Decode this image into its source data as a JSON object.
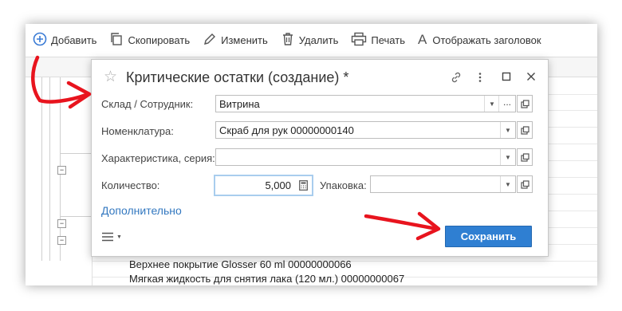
{
  "toolbar": {
    "add_label": "Добавить",
    "copy_label": "Скопировать",
    "edit_label": "Изменить",
    "delete_label": "Удалить",
    "print_label": "Печать",
    "show_title_label": "Отображать заголовок"
  },
  "list": {
    "rows": [
      "Верхнее покрытие Glosser 60 ml 00000000066",
      "Мягкая жидкость для снятия лака (120 мл.) 00000000067"
    ]
  },
  "dialog": {
    "title": "Критические остатки (создание) *",
    "fields": {
      "warehouse": {
        "label": "Склад / Сотрудник:",
        "value": "Витрина"
      },
      "item": {
        "label": "Номенклатура:",
        "value": "Скраб для рук 00000000140"
      },
      "characteristic": {
        "label": "Характеристика, серия:",
        "value": ""
      },
      "quantity": {
        "label": "Количество:",
        "value": "5,000"
      },
      "package": {
        "label": "Упаковка:",
        "value": ""
      }
    },
    "more_link": "Дополнительно",
    "save_label": "Сохранить",
    "dots_label": "..."
  },
  "colors": {
    "accent": "#2f7fd2",
    "link": "#3378c0",
    "annotation_arrow": "#e8141e",
    "add_icon": "#3a7bd5"
  }
}
